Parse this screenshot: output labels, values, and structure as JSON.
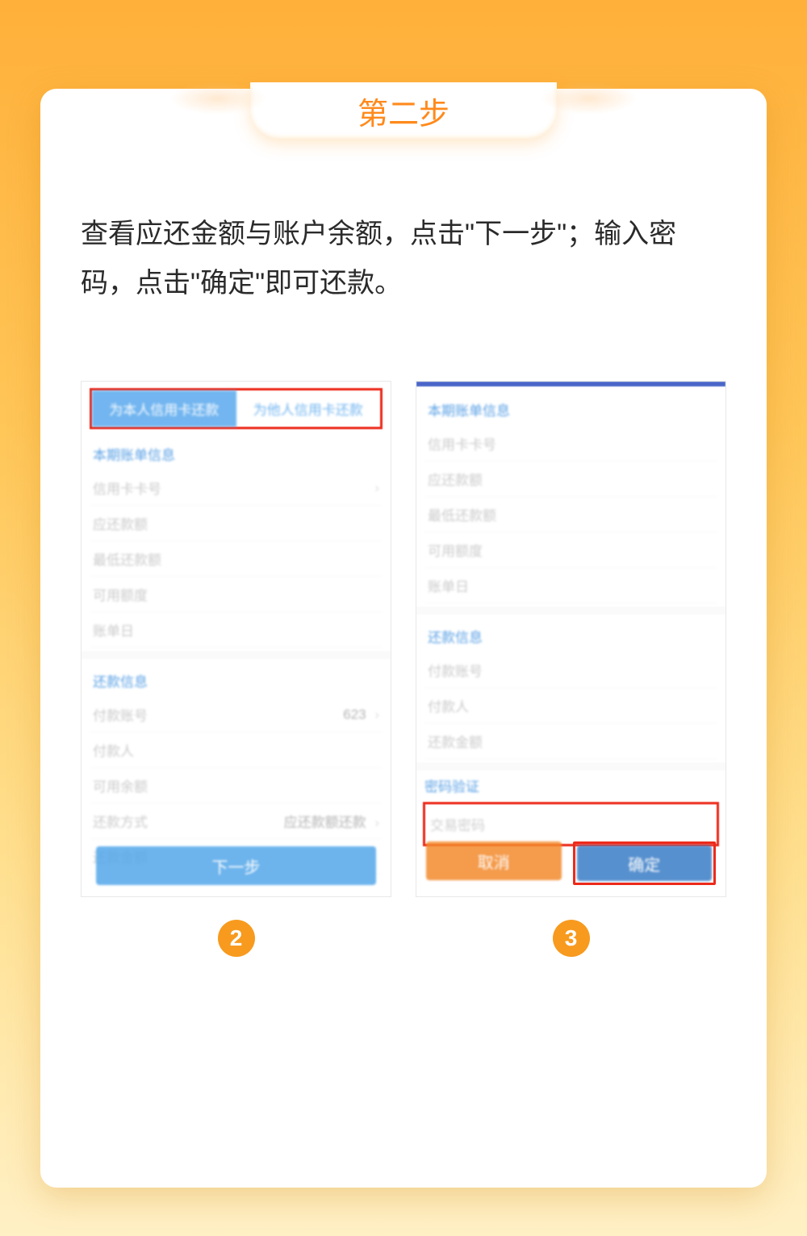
{
  "stepLabel": "第二步",
  "description": "查看应还金额与账户余额，点击\"下一步\"；输入密码，点击\"确定\"即可还款。",
  "badges": {
    "left": "2",
    "right": "3"
  },
  "phone1": {
    "tabActive": "为本人信用卡还款",
    "tabInactive": "为他人信用卡还款",
    "section1Title": "本期账单信息",
    "s1": {
      "r1": "信用卡卡号",
      "r2": "应还款额",
      "r3": "最低还款额",
      "r4": "可用额度",
      "r5": "账单日"
    },
    "section2Title": "还款信息",
    "s2": {
      "r1": "付款账号",
      "r1val": "623",
      "r2": "付款人",
      "r3": "可用余额",
      "r4": "还款方式",
      "r4val": "应还款额还款",
      "r5": "还款金额"
    },
    "nextBtn": "下一步"
  },
  "phone2": {
    "section1Title": "本期账单信息",
    "s1": {
      "r1": "信用卡卡号",
      "r2": "应还款额",
      "r3": "最低还款额",
      "r4": "可用额度",
      "r5": "账单日"
    },
    "section2Title": "还款信息",
    "s2": {
      "r1": "付款账号",
      "r2": "付款人",
      "r3": "还款金额"
    },
    "pwdSectionTitle": "密码验证",
    "pwdLabel": "交易密码",
    "cancelBtn": "取消",
    "confirmBtn": "确定"
  }
}
